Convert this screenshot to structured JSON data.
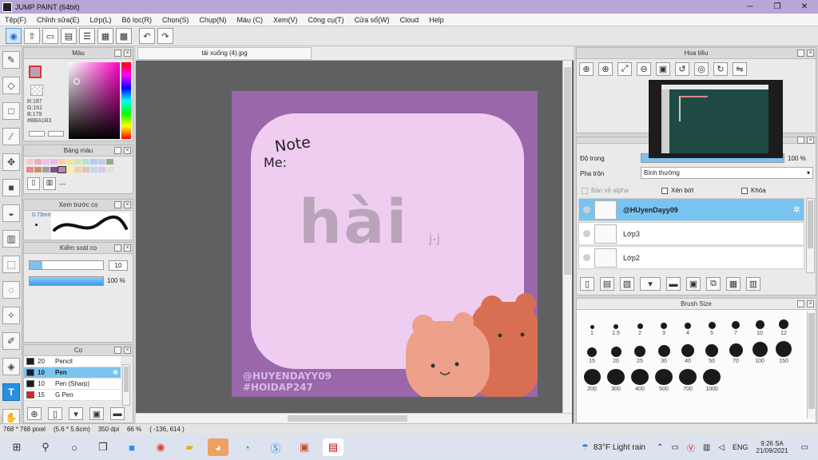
{
  "window": {
    "title": "JUMP PAINT (64bit)",
    "min": "─",
    "max": "❐",
    "close": "✕"
  },
  "menu": [
    "Tệp(F)",
    "Chỉnh sửa(E)",
    "Lớp(L)",
    "Bộ lọc(R)",
    "Chọn(S)",
    "Chụp(N)",
    "Màu (C)",
    "Xem(V)",
    "Công cụ(T)",
    "Cửa sổ(W)",
    "Cloud",
    "Help"
  ],
  "color_panel": {
    "title": "Màu",
    "r": "R:187",
    "g": "G:161",
    "b": "B:179",
    "hex": "#BBA1B3",
    "primary_color": "#BBA1B3"
  },
  "palette_panel": {
    "title": "Bảng màu",
    "dash": "---"
  },
  "preview_panel": {
    "title": "Xem trước cọ",
    "size": "0.73mm"
  },
  "brush_control": {
    "title": "Kiểm soát cọ",
    "size_value": "10",
    "density_value": "100 %"
  },
  "brush_panel": {
    "title": "Cọ",
    "items": [
      {
        "size": "20",
        "name": "Pencil",
        "color": "#1e1e1e"
      },
      {
        "size": "10",
        "name": "Pen",
        "color": "#1e1e1e"
      },
      {
        "size": "10",
        "name": "Pen (Sharp)",
        "color": "#1e1e1e"
      },
      {
        "size": "15",
        "name": "G Pen",
        "color": "#e02020"
      }
    ]
  },
  "document": {
    "tab": "tải xuống (4).jpg",
    "art": {
      "note": "Note",
      "me": "Me:",
      "word": "hài",
      "face": "j-j",
      "watermark1": "@HUYENDAYY09",
      "watermark2": "#HOIDAP247"
    }
  },
  "navigator": {
    "title": "Hoa tiêu"
  },
  "layer_panel": {
    "opacity_label": "Độ trong",
    "opacity_value": "100 %",
    "blend_label": "Pha trộn",
    "blend_value": "Bình thường",
    "protect_alpha": "Bảo vệ alpha",
    "clip": "Xén bớt",
    "lock": "Khóa",
    "layers": [
      {
        "name": "@HUyenDayy09",
        "selected": true
      },
      {
        "name": "Lớp3",
        "selected": false
      },
      {
        "name": "Lớp2",
        "selected": false
      }
    ]
  },
  "brush_size_panel": {
    "title": "Brush Size",
    "sizes": [
      "1",
      "1.5",
      "2",
      "3",
      "4",
      "5",
      "7",
      "10",
      "12",
      "15",
      "20",
      "25",
      "30",
      "40",
      "50",
      "70",
      "100",
      "150",
      "200",
      "300",
      "400",
      "500",
      "700",
      "1000"
    ]
  },
  "status": {
    "size": "768 * 768 pixel",
    "cm": "(5.6 * 5.6cm)",
    "dpi": "350 dpi",
    "zoom": "66 %",
    "coords": "( -136, 614 )"
  },
  "taskbar": {
    "weather": "83°F  Light rain",
    "lang": "ENG",
    "time": "9:26 SA",
    "date": "21/09/2021"
  }
}
